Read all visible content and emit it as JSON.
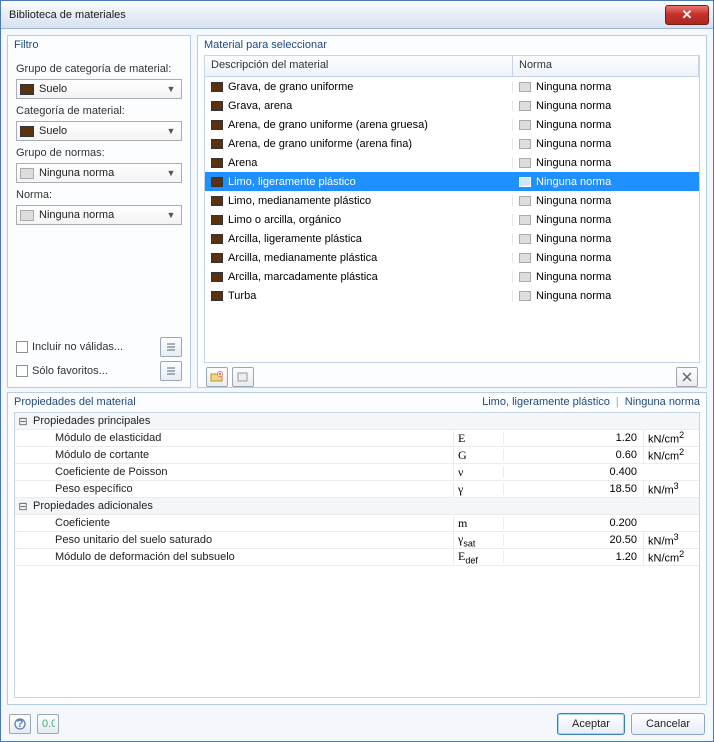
{
  "window": {
    "title": "Biblioteca de materiales"
  },
  "filter": {
    "title": "Filtro",
    "group_cat_label": "Grupo de categoría de material:",
    "group_cat_value": "Suelo",
    "cat_label": "Categoría de material:",
    "cat_value": "Suelo",
    "norm_group_label": "Grupo de normas:",
    "norm_group_value": "Ninguna norma",
    "norm_label": "Norma:",
    "norm_value": "Ninguna norma",
    "include_invalid": "Incluir no válidas...",
    "favorites_only": "Sólo favoritos..."
  },
  "material_list": {
    "title": "Material para seleccionar",
    "col_desc": "Descripción del material",
    "col_norm": "Norma",
    "items": [
      {
        "desc": "Grava, de grano uniforme",
        "norm": "Ninguna norma",
        "sel": false
      },
      {
        "desc": "Grava, arena",
        "norm": "Ninguna norma",
        "sel": false
      },
      {
        "desc": "Arena, de grano uniforme (arena gruesa)",
        "norm": "Ninguna norma",
        "sel": false
      },
      {
        "desc": "Arena, de grano uniforme (arena fina)",
        "norm": "Ninguna norma",
        "sel": false
      },
      {
        "desc": "Arena",
        "norm": "Ninguna norma",
        "sel": false
      },
      {
        "desc": "Limo, ligeramente plástico",
        "norm": "Ninguna norma",
        "sel": true
      },
      {
        "desc": "Limo, medianamente plástico",
        "norm": "Ninguna norma",
        "sel": false
      },
      {
        "desc": "Limo o arcilla, orgánico",
        "norm": "Ninguna norma",
        "sel": false
      },
      {
        "desc": "Arcilla, ligeramente plástica",
        "norm": "Ninguna norma",
        "sel": false
      },
      {
        "desc": "Arcilla, medianamente plástica",
        "norm": "Ninguna norma",
        "sel": false
      },
      {
        "desc": "Arcilla, marcadamente plástica",
        "norm": "Ninguna norma",
        "sel": false
      },
      {
        "desc": "Turba",
        "norm": "Ninguna norma",
        "sel": false
      }
    ]
  },
  "props": {
    "title": "Propiedades del material",
    "selected_desc": "Limo, ligeramente plástico",
    "selected_norm": "Ninguna norma",
    "group_main": "Propiedades principales",
    "group_add": "Propiedades adicionales",
    "rows_main": [
      {
        "name": "Módulo de elasticidad",
        "sym": "E",
        "val": "1.20",
        "unit": "kN/cm²"
      },
      {
        "name": "Módulo de cortante",
        "sym": "G",
        "val": "0.60",
        "unit": "kN/cm²"
      },
      {
        "name": "Coeficiente de Poisson",
        "sym": "ν",
        "val": "0.400",
        "unit": ""
      },
      {
        "name": "Peso específico",
        "sym": "γ",
        "val": "18.50",
        "unit": "kN/m³"
      }
    ],
    "rows_add": [
      {
        "name": "Coeficiente",
        "sym": "m",
        "val": "0.200",
        "unit": ""
      },
      {
        "name": "Peso unitario del suelo saturado",
        "sym": "γ",
        "sub": "sat",
        "val": "20.50",
        "unit": "kN/m³"
      },
      {
        "name": "Módulo de deformación del subsuelo",
        "sym": "E",
        "sub": "def",
        "val": "1.20",
        "unit": "kN/cm²"
      }
    ]
  },
  "buttons": {
    "ok": "Aceptar",
    "cancel": "Cancelar"
  }
}
